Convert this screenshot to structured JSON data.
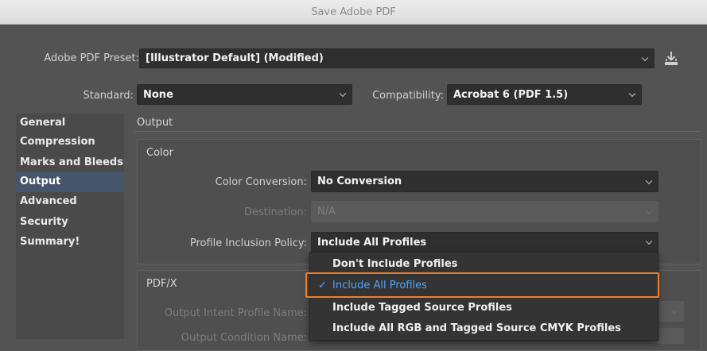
{
  "window": {
    "title": "Save Adobe PDF"
  },
  "preset": {
    "label": "Adobe PDF Preset:",
    "value": "[Illustrator Default] (Modified)"
  },
  "standard": {
    "label": "Standard:",
    "value": "None"
  },
  "compatibility": {
    "label": "Compatibility:",
    "value": "Acrobat 6 (PDF 1.5)"
  },
  "sidebar": {
    "items": [
      {
        "label": "General"
      },
      {
        "label": "Compression"
      },
      {
        "label": "Marks and Bleeds"
      },
      {
        "label": "Output",
        "active": true
      },
      {
        "label": "Advanced"
      },
      {
        "label": "Security"
      },
      {
        "label": "Summary!"
      }
    ]
  },
  "main": {
    "section_title": "Output",
    "color_group": {
      "title": "Color",
      "color_conversion": {
        "label": "Color Conversion:",
        "value": "No Conversion"
      },
      "destination": {
        "label": "Destination:",
        "value": "N/A"
      },
      "profile_policy": {
        "label": "Profile Inclusion Policy:",
        "value": "Include All Profiles"
      }
    },
    "pdfx_group": {
      "title": "PDF/X",
      "output_intent": {
        "label": "Output Intent Profile Name:"
      },
      "output_condition": {
        "label": "Output Condition Name:"
      }
    }
  },
  "dropdown": {
    "options": [
      {
        "label": "Don't Include Profiles"
      },
      {
        "label": "Include All Profiles",
        "checked": true
      },
      {
        "label": "Include Tagged Source Profiles"
      },
      {
        "label": "Include All RGB and Tagged Source CMYK Profiles"
      }
    ]
  },
  "colors": {
    "accent": "#4ea3ff",
    "highlight": "#ee7f2d",
    "selected_nav": "#45556b"
  }
}
